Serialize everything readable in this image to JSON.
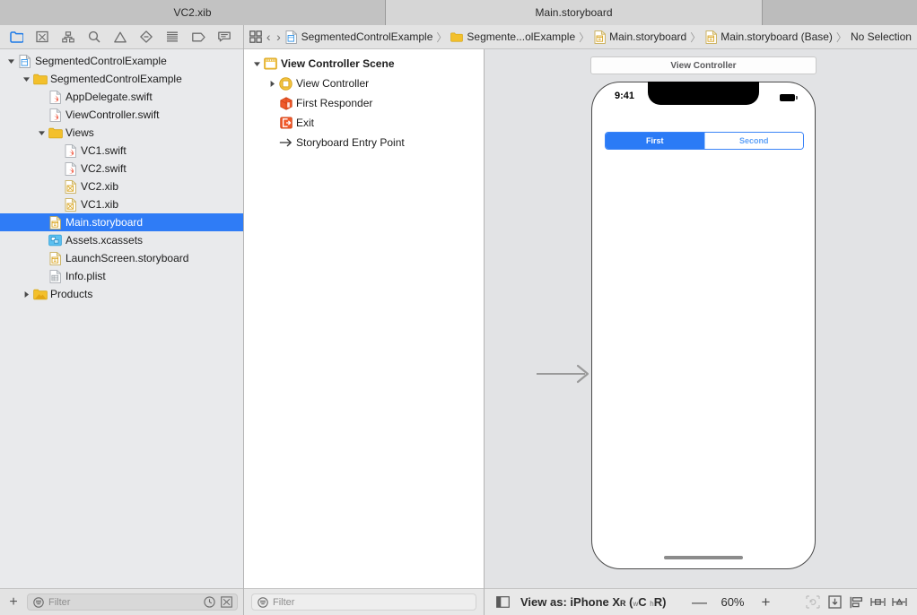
{
  "window": {
    "tabs": [
      {
        "label": "VC2.xib",
        "active": false
      },
      {
        "label": "Main.storyboard",
        "active": true
      }
    ]
  },
  "navigator": {
    "toolbar_icons": [
      "project-navigator-icon",
      "source-control-navigator-icon",
      "symbol-navigator-icon",
      "find-navigator-icon",
      "issue-navigator-icon",
      "test-navigator-icon",
      "debug-navigator-icon",
      "breakpoint-navigator-icon",
      "report-navigator-icon"
    ],
    "tree": [
      {
        "label": "SegmentedControlExample",
        "icon": "project-icon",
        "depth": 0,
        "twisty": "down",
        "selected": false
      },
      {
        "label": "SegmentedControlExample",
        "icon": "folder-icon",
        "depth": 1,
        "twisty": "down",
        "selected": false
      },
      {
        "label": "AppDelegate.swift",
        "icon": "swift-file-icon",
        "depth": 2,
        "twisty": "none",
        "selected": false
      },
      {
        "label": "ViewController.swift",
        "icon": "swift-file-icon",
        "depth": 2,
        "twisty": "none",
        "selected": false
      },
      {
        "label": "Views",
        "icon": "folder-icon",
        "depth": 2,
        "twisty": "down",
        "selected": false
      },
      {
        "label": "VC1.swift",
        "icon": "swift-file-icon",
        "depth": 3,
        "twisty": "none",
        "selected": false
      },
      {
        "label": "VC2.swift",
        "icon": "swift-file-icon",
        "depth": 3,
        "twisty": "none",
        "selected": false
      },
      {
        "label": "VC2.xib",
        "icon": "xib-file-icon",
        "depth": 3,
        "twisty": "none",
        "selected": false
      },
      {
        "label": "VC1.xib",
        "icon": "xib-file-icon",
        "depth": 3,
        "twisty": "none",
        "selected": false
      },
      {
        "label": "Main.storyboard",
        "icon": "storyboard-file-icon",
        "depth": 2,
        "twisty": "none",
        "selected": true
      },
      {
        "label": "Assets.xcassets",
        "icon": "assets-icon",
        "depth": 2,
        "twisty": "none",
        "selected": false
      },
      {
        "label": "LaunchScreen.storyboard",
        "icon": "storyboard-file-icon",
        "depth": 2,
        "twisty": "none",
        "selected": false
      },
      {
        "label": "Info.plist",
        "icon": "plist-file-icon",
        "depth": 2,
        "twisty": "none",
        "selected": false
      },
      {
        "label": "Products",
        "icon": "products-folder-icon",
        "depth": 1,
        "twisty": "right",
        "selected": false
      }
    ],
    "filter": {
      "placeholder": "Filter",
      "value": ""
    },
    "add_label": "+"
  },
  "outline": {
    "items": [
      {
        "label": "View Controller Scene",
        "icon": "scene-icon",
        "depth": 0,
        "twisty": "down",
        "bold": true
      },
      {
        "label": "View Controller",
        "icon": "view-controller-icon",
        "depth": 1,
        "twisty": "right",
        "bold": false
      },
      {
        "label": "First Responder",
        "icon": "first-responder-icon",
        "depth": 1,
        "twisty": "none",
        "bold": false
      },
      {
        "label": "Exit",
        "icon": "exit-icon",
        "depth": 1,
        "twisty": "none",
        "bold": false
      },
      {
        "label": "Storyboard Entry Point",
        "icon": "entry-point-arrow-icon",
        "depth": 1,
        "twisty": "none",
        "bold": false
      }
    ],
    "filter": {
      "placeholder": "Filter",
      "value": ""
    }
  },
  "jumpbar": {
    "crumbs": [
      {
        "label": "SegmentedControlExample",
        "icon": "project-icon"
      },
      {
        "label": "Segmente...olExample",
        "icon": "folder-icon"
      },
      {
        "label": "Main.storyboard",
        "icon": "storyboard-file-icon"
      },
      {
        "label": "Main.storyboard (Base)",
        "icon": "storyboard-file-icon"
      },
      {
        "label": "No Selection",
        "icon": "none"
      }
    ],
    "back_label": "‹",
    "forward_label": "›",
    "related_items_icon": "related-items-icon"
  },
  "canvas": {
    "scene_label": "View Controller",
    "device": {
      "status_time": "9:41",
      "battery_icon": "battery-icon"
    },
    "segmented_control": {
      "segments": [
        {
          "label": "First",
          "selected": true
        },
        {
          "label": "Second",
          "selected": false
        }
      ],
      "tint_color": "#2b7bf6"
    },
    "entry_arrow_icon": "storyboard-entry-arrow-icon"
  },
  "canvas_bar": {
    "panel_toggle_icon": "document-outline-toggle-icon",
    "view_as_prefix": "View as:",
    "device_name": "iPhone X",
    "device_suffix": "R",
    "size_class_w_prefix": "w",
    "size_class_w": "C",
    "size_class_h_prefix": "h",
    "size_class_h": "R",
    "zoom_out_label": "—",
    "zoom_level": "60%",
    "zoom_in_label": "+",
    "right_icons": [
      "update-frames-icon",
      "embed-in-icon",
      "align-icon",
      "pin-icon",
      "resolve-auto-layout-icon"
    ]
  }
}
